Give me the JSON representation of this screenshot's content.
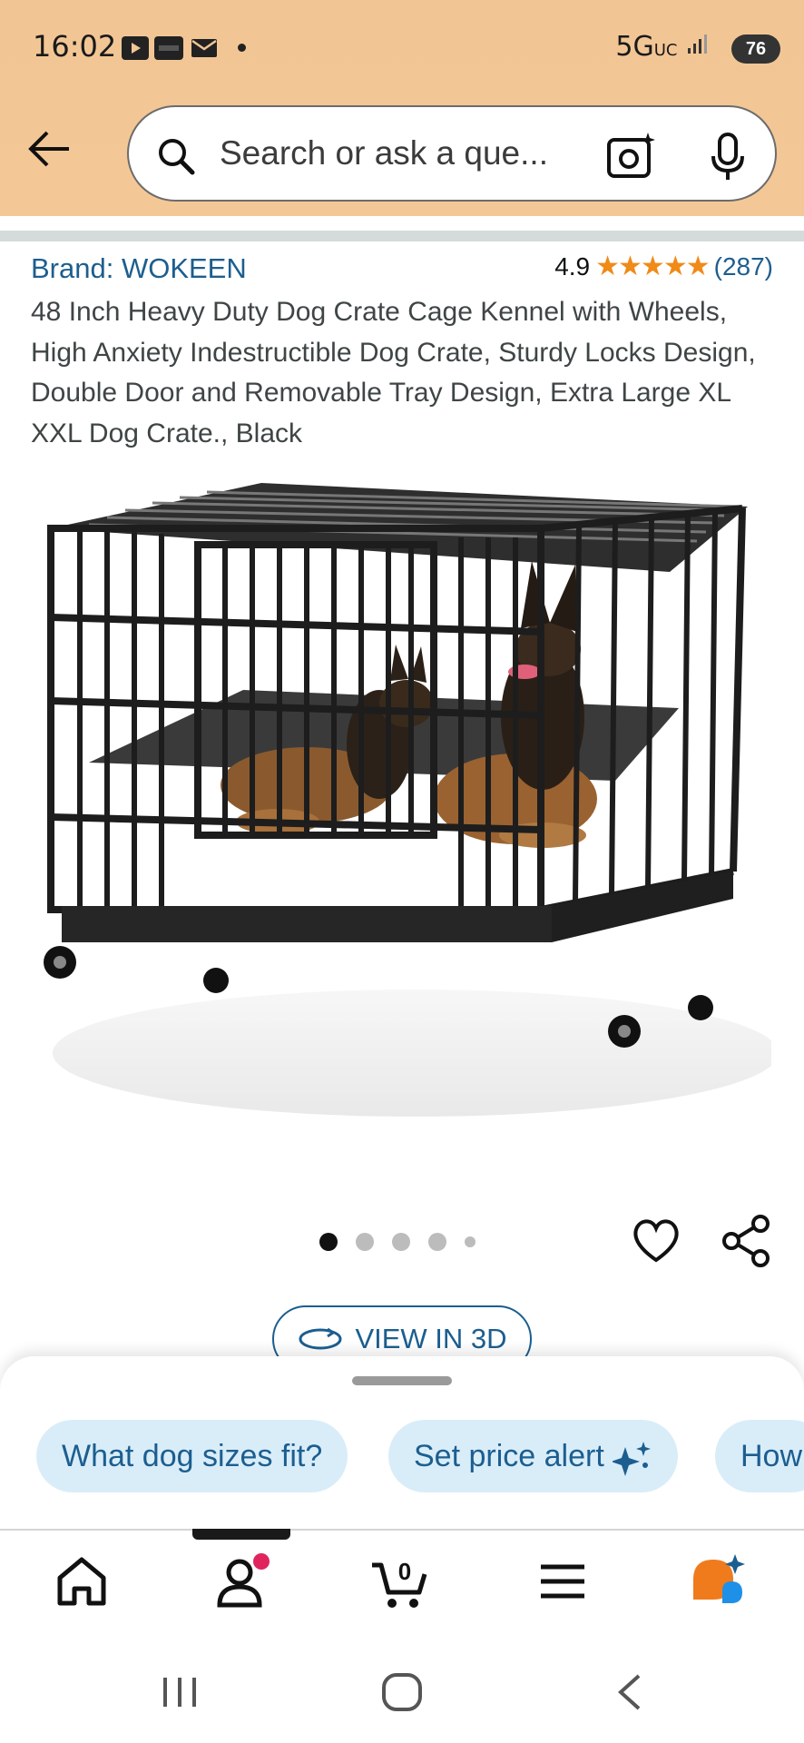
{
  "status_bar": {
    "time": "16:02",
    "network": "5G",
    "network_sub": "UC",
    "battery": "76"
  },
  "search": {
    "placeholder": "Search or ask a que..."
  },
  "product": {
    "brand": "Brand: WOKEEN",
    "rating": "4.9",
    "stars": "★★★★★",
    "review_count": "(287)",
    "title": "48 Inch Heavy Duty Dog Crate Cage Kennel with Wheels, High Anxiety Indestructible Dog Crate, Sturdy Locks Design, Double Door and Removable Tray Design, Extra Large XL XXL Dog Crate., Black"
  },
  "carousel": {
    "image_count": 5,
    "active_index": 0
  },
  "view_3d": {
    "label": "VIEW IN 3D"
  },
  "suggestions": [
    {
      "label": "What dog sizes fit?"
    },
    {
      "label": "Set price alert"
    },
    {
      "label": "How"
    }
  ],
  "bottom_nav": {
    "cart_count": "0",
    "items": [
      "home-icon",
      "account-icon",
      "cart-icon",
      "menu-icon",
      "rufus-assistant-icon"
    ]
  },
  "colors": {
    "header": "#f3c695",
    "link": "#1c5e8f",
    "star": "#f08a18",
    "chip_bg": "#d9edf9",
    "notify": "#e0245e"
  }
}
